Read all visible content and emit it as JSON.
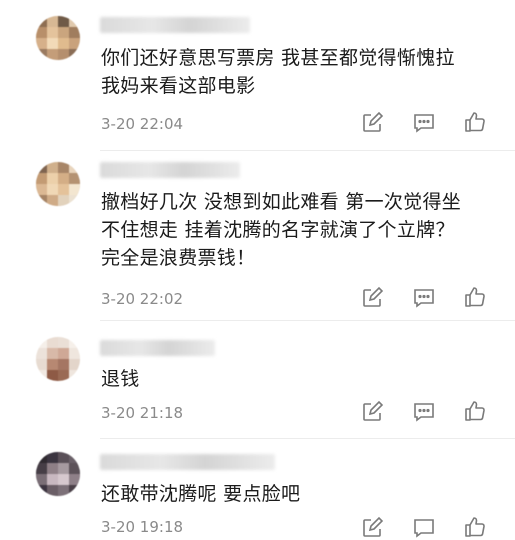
{
  "comments": [
    {
      "text": "你们还好意思写票房 我甚至都觉得惭愧拉\n我妈来看这部电影",
      "time": "3-20 22:04"
    },
    {
      "text": "撤档好几次 没想到如此难看 第一次觉得坐\n不住想走 挂着沈腾的名字就演了个立牌？\n完全是浪费票钱！",
      "time": "3-20 22:02"
    },
    {
      "text": "退钱",
      "time": "3-20 21:18"
    },
    {
      "text": "还敢带沈腾呢 要点脸吧",
      "time": "3-20 19:18"
    }
  ],
  "icons": {
    "edit": "edit-icon",
    "reply": "comment-icon",
    "like": "thumbs-up-icon"
  },
  "colors": {
    "text": "#1b1b1b",
    "time": "#8a8a8a",
    "icon": "#7a7a7a",
    "divider": "#ececec"
  }
}
